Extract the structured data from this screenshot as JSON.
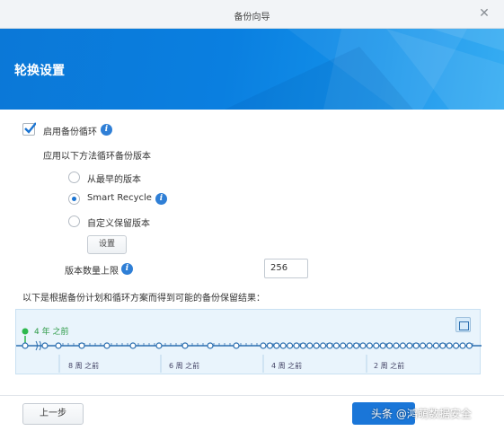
{
  "window": {
    "title": "备份向导"
  },
  "banner": {
    "heading": "轮换设置"
  },
  "rotation": {
    "enable_label": "启用备份循环",
    "enable_checked": true,
    "method_prompt": "应用以下方法循环备份版本",
    "options": [
      {
        "label": "从最早的版本",
        "selected": false
      },
      {
        "label": "Smart Recycle",
        "selected": true
      },
      {
        "label": "自定义保留版本",
        "selected": false
      }
    ],
    "settings_button": "设置",
    "max_versions_label": "版本数量上限",
    "max_versions_value": "256"
  },
  "timeline": {
    "description": "以下是根据备份计划和循环方案而得到可能的备份保留结果：",
    "marker_label": "4 年 之前",
    "tick_labels": [
      "8 周 之前",
      "6 周 之前",
      "4 周 之前",
      "2 周 之前"
    ]
  },
  "footer": {
    "back_button": "上一步",
    "watermark": "头条 @鸿萌数据安全"
  },
  "colors": {
    "accent": "#1a76d8",
    "timeline_line": "#2c6fb0",
    "marker": "#2db84d"
  }
}
